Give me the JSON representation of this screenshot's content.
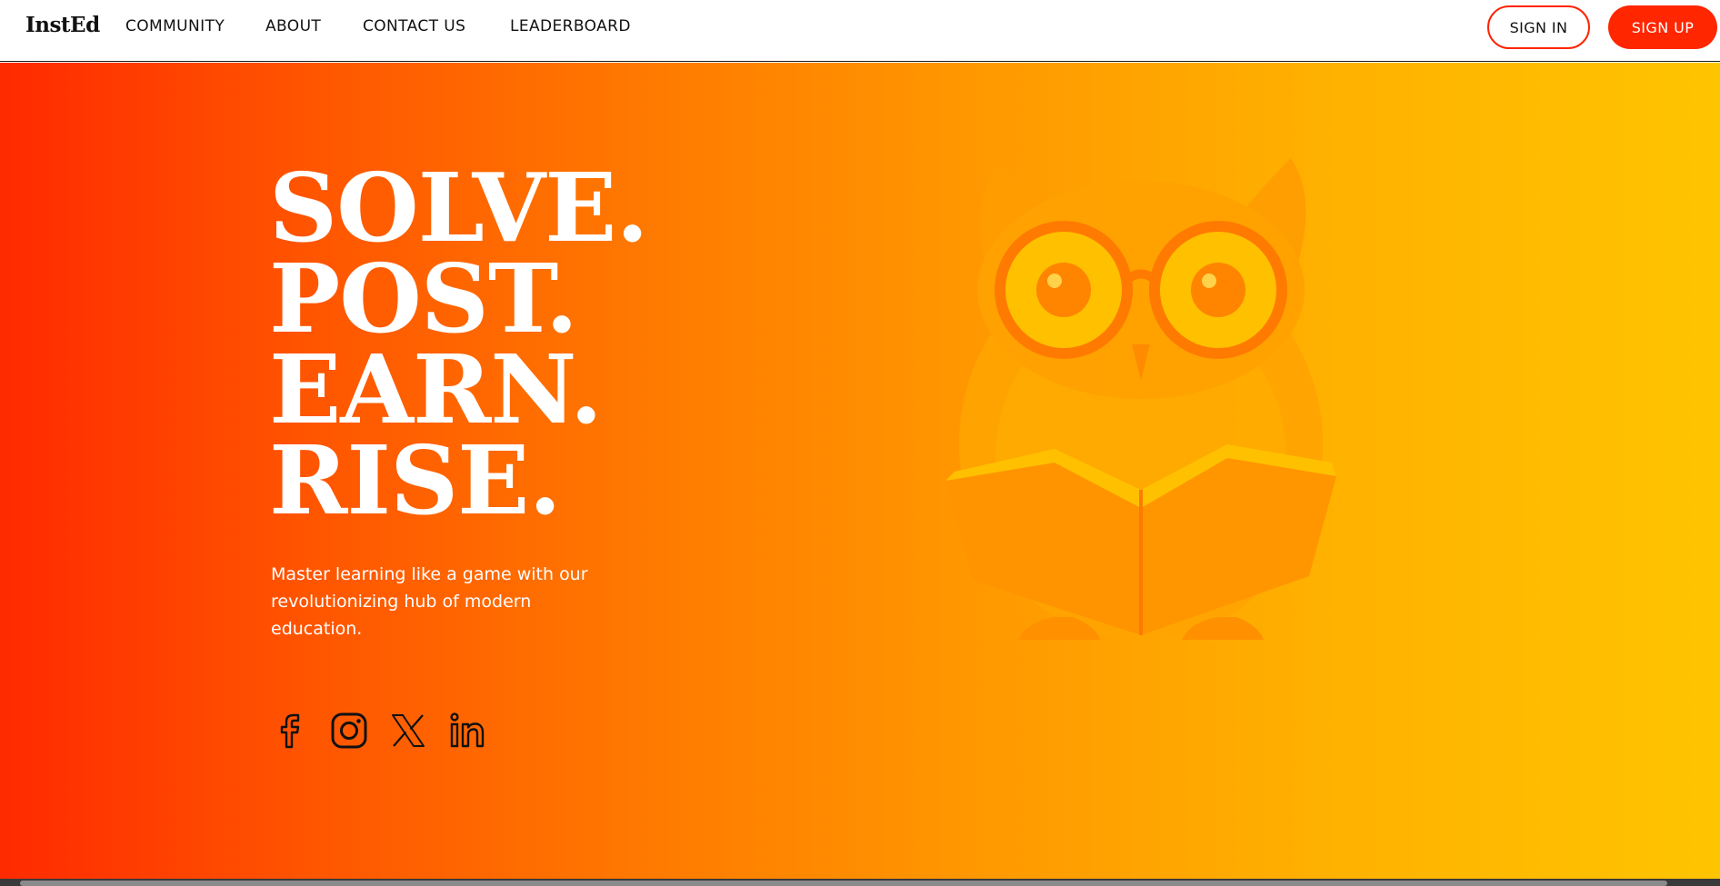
{
  "brand": {
    "logo": "InstEd"
  },
  "nav": {
    "links": [
      "COMMUNITY",
      "ABOUT",
      "CONTACT US",
      "LEADERBOARD"
    ],
    "signin_label": "SIGN IN",
    "signup_label": "SIGN UP"
  },
  "hero": {
    "headline": [
      "SOLVE.",
      "POST.",
      "EARN.",
      "RISE."
    ],
    "tagline": "Master learning like a game with our revolutionizing hub of modern education.",
    "socials": [
      "facebook-icon",
      "instagram-icon",
      "x-icon",
      "linkedin-icon"
    ],
    "illustration": "owl-reading-book"
  },
  "colors": {
    "accent": "#ff2600",
    "gradient_start": "#ff2a00",
    "gradient_end": "#ffc400",
    "text_dark": "#111111",
    "text_light": "#ffffff"
  }
}
